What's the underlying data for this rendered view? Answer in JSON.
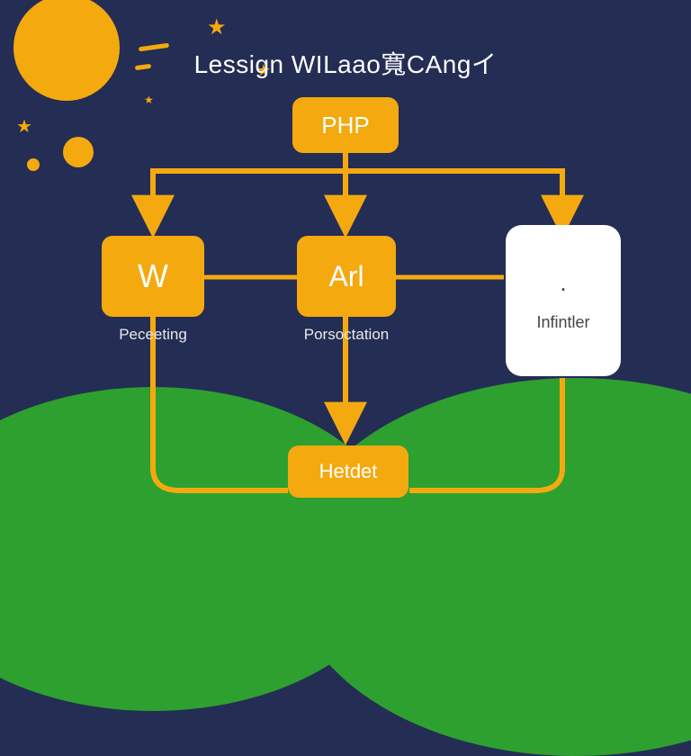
{
  "title": "Lessign WILaao寬CAngイ",
  "nodes": {
    "top": {
      "label": "PHP"
    },
    "left": {
      "label": "W",
      "caption": "Peceeting"
    },
    "mid": {
      "label": "Arl",
      "caption": "Porsoctation"
    },
    "right": {
      "label": ".",
      "caption": "Infintler"
    },
    "bottom": {
      "label": "Hetdet"
    }
  },
  "colors": {
    "sky": "#242d54",
    "accent": "#f4a90f",
    "hill": "#2ea02f",
    "card_white": "#ffffff"
  }
}
